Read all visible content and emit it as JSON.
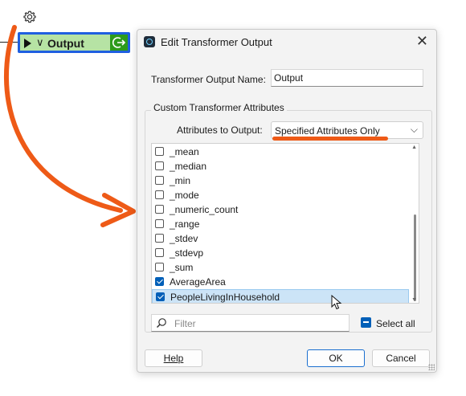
{
  "canvas": {
    "node_label": "Output",
    "node_chevron": "∨"
  },
  "dialog": {
    "title": "Edit Transformer Output",
    "close_glyph": "✕",
    "output_name_label": "Transformer Output Name:",
    "output_name_value": "Output",
    "group_title": "Custom Transformer Attributes",
    "attributes_label": "Attributes to Output:",
    "attributes_value": "Specified Attributes Only",
    "attributes": [
      {
        "name": "_mean",
        "checked": false
      },
      {
        "name": "_median",
        "checked": false
      },
      {
        "name": "_min",
        "checked": false
      },
      {
        "name": "_mode",
        "checked": false
      },
      {
        "name": "_numeric_count",
        "checked": false
      },
      {
        "name": "_range",
        "checked": false
      },
      {
        "name": "_stdev",
        "checked": false
      },
      {
        "name": "_stdevp",
        "checked": false
      },
      {
        "name": "_sum",
        "checked": false
      },
      {
        "name": "AverageArea",
        "checked": true
      },
      {
        "name": "PeopleLivingInHousehold",
        "checked": true,
        "selected": true
      }
    ],
    "filter_placeholder": "Filter",
    "select_all_label": "Select all",
    "help_label": "Help",
    "ok_label": "OK",
    "cancel_label": "Cancel"
  },
  "colors": {
    "accent": "#005fb8",
    "annotation": "#ee5a17",
    "node_fill": "#b6e3a4",
    "node_border": "#1f5fe0"
  },
  "icons": [
    "gear-icon",
    "play-icon",
    "connector-icon",
    "app-icon",
    "close-icon",
    "dropdown-chevron-icon",
    "search-icon"
  ]
}
